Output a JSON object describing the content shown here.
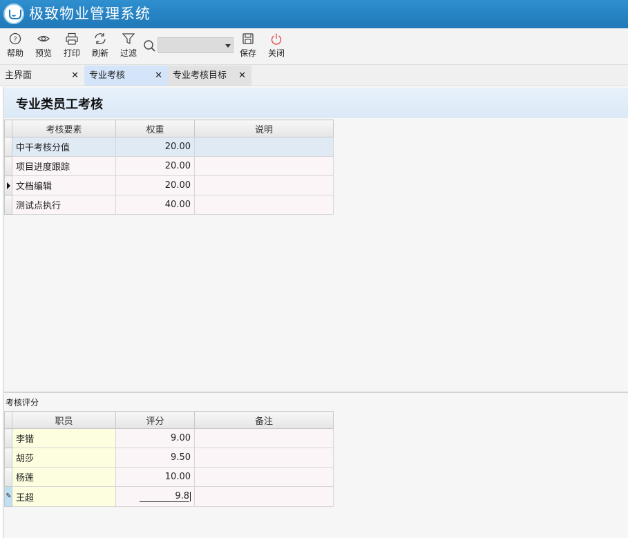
{
  "app": {
    "title": "极致物业管理系统"
  },
  "toolbar": {
    "help": "帮助",
    "preview": "预览",
    "print": "打印",
    "refresh": "刷新",
    "filter": "过滤",
    "save": "保存",
    "close": "关闭",
    "close_icon_color": "#e05050"
  },
  "tabs": [
    {
      "label": "主界面",
      "active": false
    },
    {
      "label": "专业考核",
      "active": true
    },
    {
      "label": "专业考核目标",
      "active": false
    }
  ],
  "page": {
    "title": "专业类员工考核"
  },
  "criteria_table": {
    "columns": [
      "考核要素",
      "权重",
      "说明"
    ],
    "rows": [
      {
        "item": "中干考核分值",
        "weight": "20.00",
        "note": ""
      },
      {
        "item": "项目进度跟踪",
        "weight": "20.00",
        "note": ""
      },
      {
        "item": "文档编辑",
        "weight": "20.00",
        "note": "",
        "current": true
      },
      {
        "item": "测试点执行",
        "weight": "40.00",
        "note": ""
      }
    ]
  },
  "scores_section": {
    "caption": "考核评分"
  },
  "scores_table": {
    "columns": [
      "职员",
      "评分",
      "备注"
    ],
    "rows": [
      {
        "name": "李锴",
        "score": "9.00",
        "remark": ""
      },
      {
        "name": "胡莎",
        "score": "9.50",
        "remark": ""
      },
      {
        "name": "杨莲",
        "score": "10.00",
        "remark": ""
      },
      {
        "name": "王超",
        "score": "9.8",
        "remark": "",
        "editing": true
      }
    ]
  }
}
